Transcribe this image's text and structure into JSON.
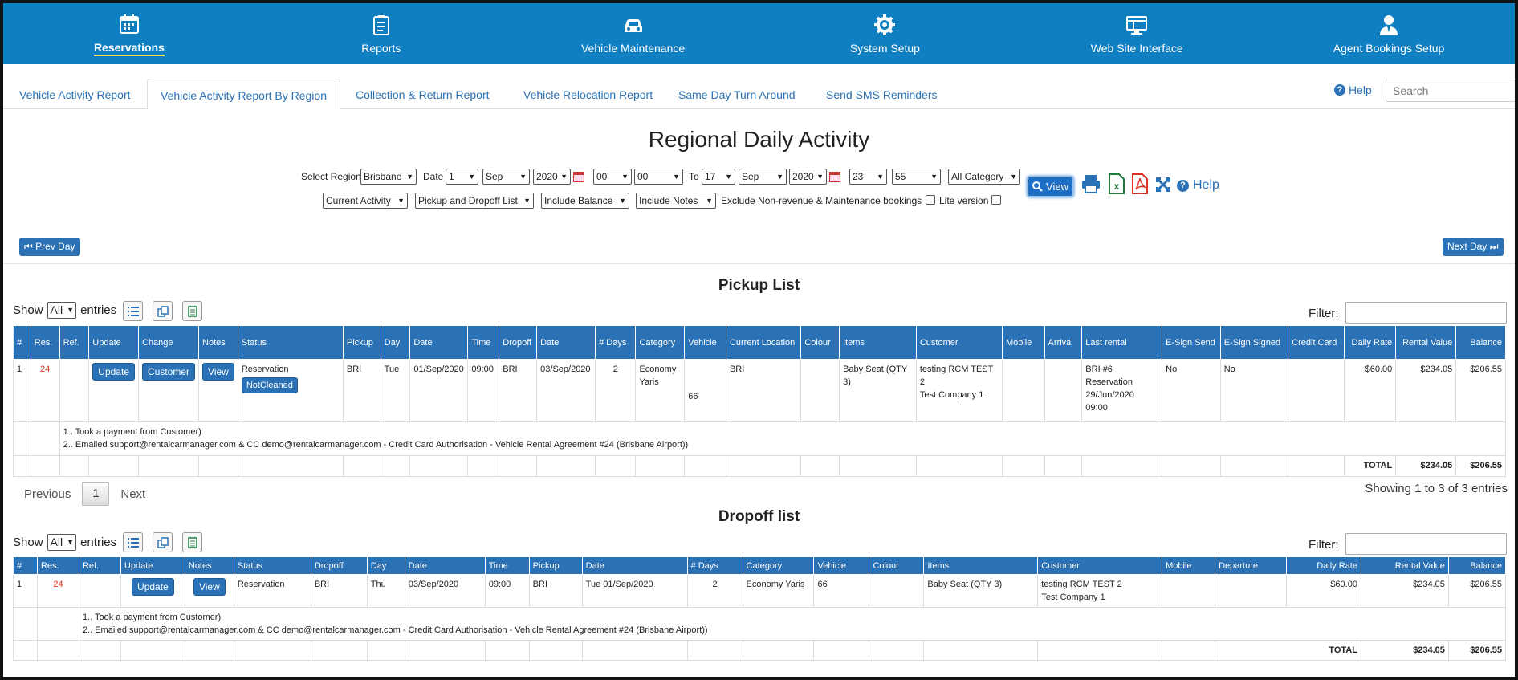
{
  "nav": [
    {
      "label": "Reservations",
      "icon": "calendar-icon"
    },
    {
      "label": "Reports",
      "icon": "clipboard-icon"
    },
    {
      "label": "Vehicle Maintenance",
      "icon": "car-icon"
    },
    {
      "label": "System Setup",
      "icon": "gear-icon"
    },
    {
      "label": "Web Site Interface",
      "icon": "monitor-icon"
    },
    {
      "label": "Agent Bookings Setup",
      "icon": "user-icon"
    }
  ],
  "tabs": [
    "Vehicle Activity Report",
    "Vehicle Activity Report By Region",
    "Collection & Return Report",
    "Vehicle Relocation Report",
    "Same Day Turn Around",
    "Send SMS Reminders"
  ],
  "help_label": "Help",
  "search_placeholder": "Search",
  "page_title": "Regional Daily Activity",
  "filters": {
    "select_region_label": "Select Region",
    "region": "Brisbane",
    "date_label": "Date",
    "from_day": "1",
    "from_month": "Sep",
    "from_year": "2020",
    "from_hour": "00",
    "from_min": "00",
    "to_label": "To",
    "to_day": "17",
    "to_month": "Sep",
    "to_year": "2020",
    "to_hour": "23",
    "to_min": "55",
    "category": "All Category",
    "activity": "Current Activity",
    "list_type": "Pickup and Dropoff List",
    "balance": "Include Balance",
    "notes": "Include Notes",
    "exclude_label": "Exclude Non-revenue & Maintenance bookings",
    "lite_label": "Lite version",
    "view_label": "View",
    "help_label": "Help"
  },
  "prev_day": "Prev Day",
  "next_day": "Next Day",
  "pickup": {
    "title": "Pickup List",
    "show": "Show",
    "show_value": "All",
    "entries": "entries",
    "filter": "Filter:",
    "headers": [
      "#",
      "Res.",
      "Ref.",
      "Update",
      "Change",
      "Notes",
      "Status",
      "Pickup",
      "Day",
      "Date",
      "Time",
      "Dropoff",
      "Date",
      "# Days",
      "Category",
      "Vehicle",
      "Current Location",
      "Colour",
      "Items",
      "Customer",
      "Mobile",
      "Arrival",
      "Last rental",
      "E-Sign Send",
      "E-Sign Signed",
      "Credit Card",
      "Daily Rate",
      "Rental Value",
      "Balance"
    ],
    "row": {
      "num": "1",
      "res": "24",
      "ref": "",
      "update": "Update",
      "change": "Customer",
      "notes": "View",
      "status": "Reservation",
      "status_badge": "NotCleaned",
      "pickup": "BRI",
      "day": "Tue",
      "date": "01/Sep/2020",
      "time": "09:00",
      "dropoff": "BRI",
      "date2": "03/Sep/2020",
      "days": "2",
      "category": "Economy Yaris",
      "vehicle": "66",
      "location": "BRI",
      "colour": "",
      "items": "Baby Seat (QTY 3)",
      "customer": "testing RCM TEST 2",
      "customer2": "Test Company 1",
      "mobile": "",
      "arrival": "",
      "last_rental": "BRI #6 Reservation 29/Jun/2020 09:00",
      "esign_send": "No",
      "esign_signed": "No",
      "credit_card": "",
      "daily_rate": "$60.00",
      "rental_value": "$234.05",
      "balance": "$206.55"
    },
    "note1": "1.. Took a payment from Customer)",
    "note2": "2.. Emailed support@rentalcarmanager.com & CC demo@rentalcarmanager.com - Credit Card Authorisation - Vehicle Rental Agreement #24 (Brisbane Airport))",
    "total_label": "TOTAL",
    "total_rental": "$234.05",
    "total_balance": "$206.55",
    "prev": "Previous",
    "page": "1",
    "next": "Next",
    "showing": "Showing 1 to 3 of 3 entries"
  },
  "dropoff": {
    "title": "Dropoff list",
    "show": "Show",
    "show_value": "All",
    "entries": "entries",
    "filter": "Filter:",
    "headers": [
      "#",
      "Res.",
      "Ref.",
      "Update",
      "Notes",
      "Status",
      "Dropoff",
      "Day",
      "Date",
      "Time",
      "Pickup",
      "Date",
      "# Days",
      "Category",
      "Vehicle",
      "Colour",
      "Items",
      "Customer",
      "Mobile",
      "Departure",
      "Daily Rate",
      "Rental Value",
      "Balance"
    ],
    "row": {
      "num": "1",
      "res": "24",
      "ref": "",
      "update": "Update",
      "notes": "View",
      "status": "Reservation",
      "dropoff": "BRI",
      "day": "Thu",
      "date": "03/Sep/2020",
      "time": "09:00",
      "pickup": "BRI",
      "date2": "Tue 01/Sep/2020",
      "days": "2",
      "category": "Economy Yaris",
      "vehicle": "66",
      "colour": "",
      "items": "Baby Seat (QTY 3)",
      "customer": "testing RCM TEST 2",
      "customer2": "Test Company 1",
      "mobile": "",
      "departure": "",
      "daily_rate": "$60.00",
      "rental_value": "$234.05",
      "balance": "$206.55"
    },
    "note1": "1.. Took a payment from Customer)",
    "note2": "2.. Emailed support@rentalcarmanager.com & CC demo@rentalcarmanager.com - Credit Card Authorisation - Vehicle Rental Agreement #24 (Brisbane Airport))",
    "total_label": "TOTAL",
    "total_rental": "$234.05",
    "total_balance": "$206.55"
  },
  "colors": {
    "nav_bg": "#0f7fc1",
    "accent": "#2a72b5",
    "res_link": "#dd3322"
  }
}
